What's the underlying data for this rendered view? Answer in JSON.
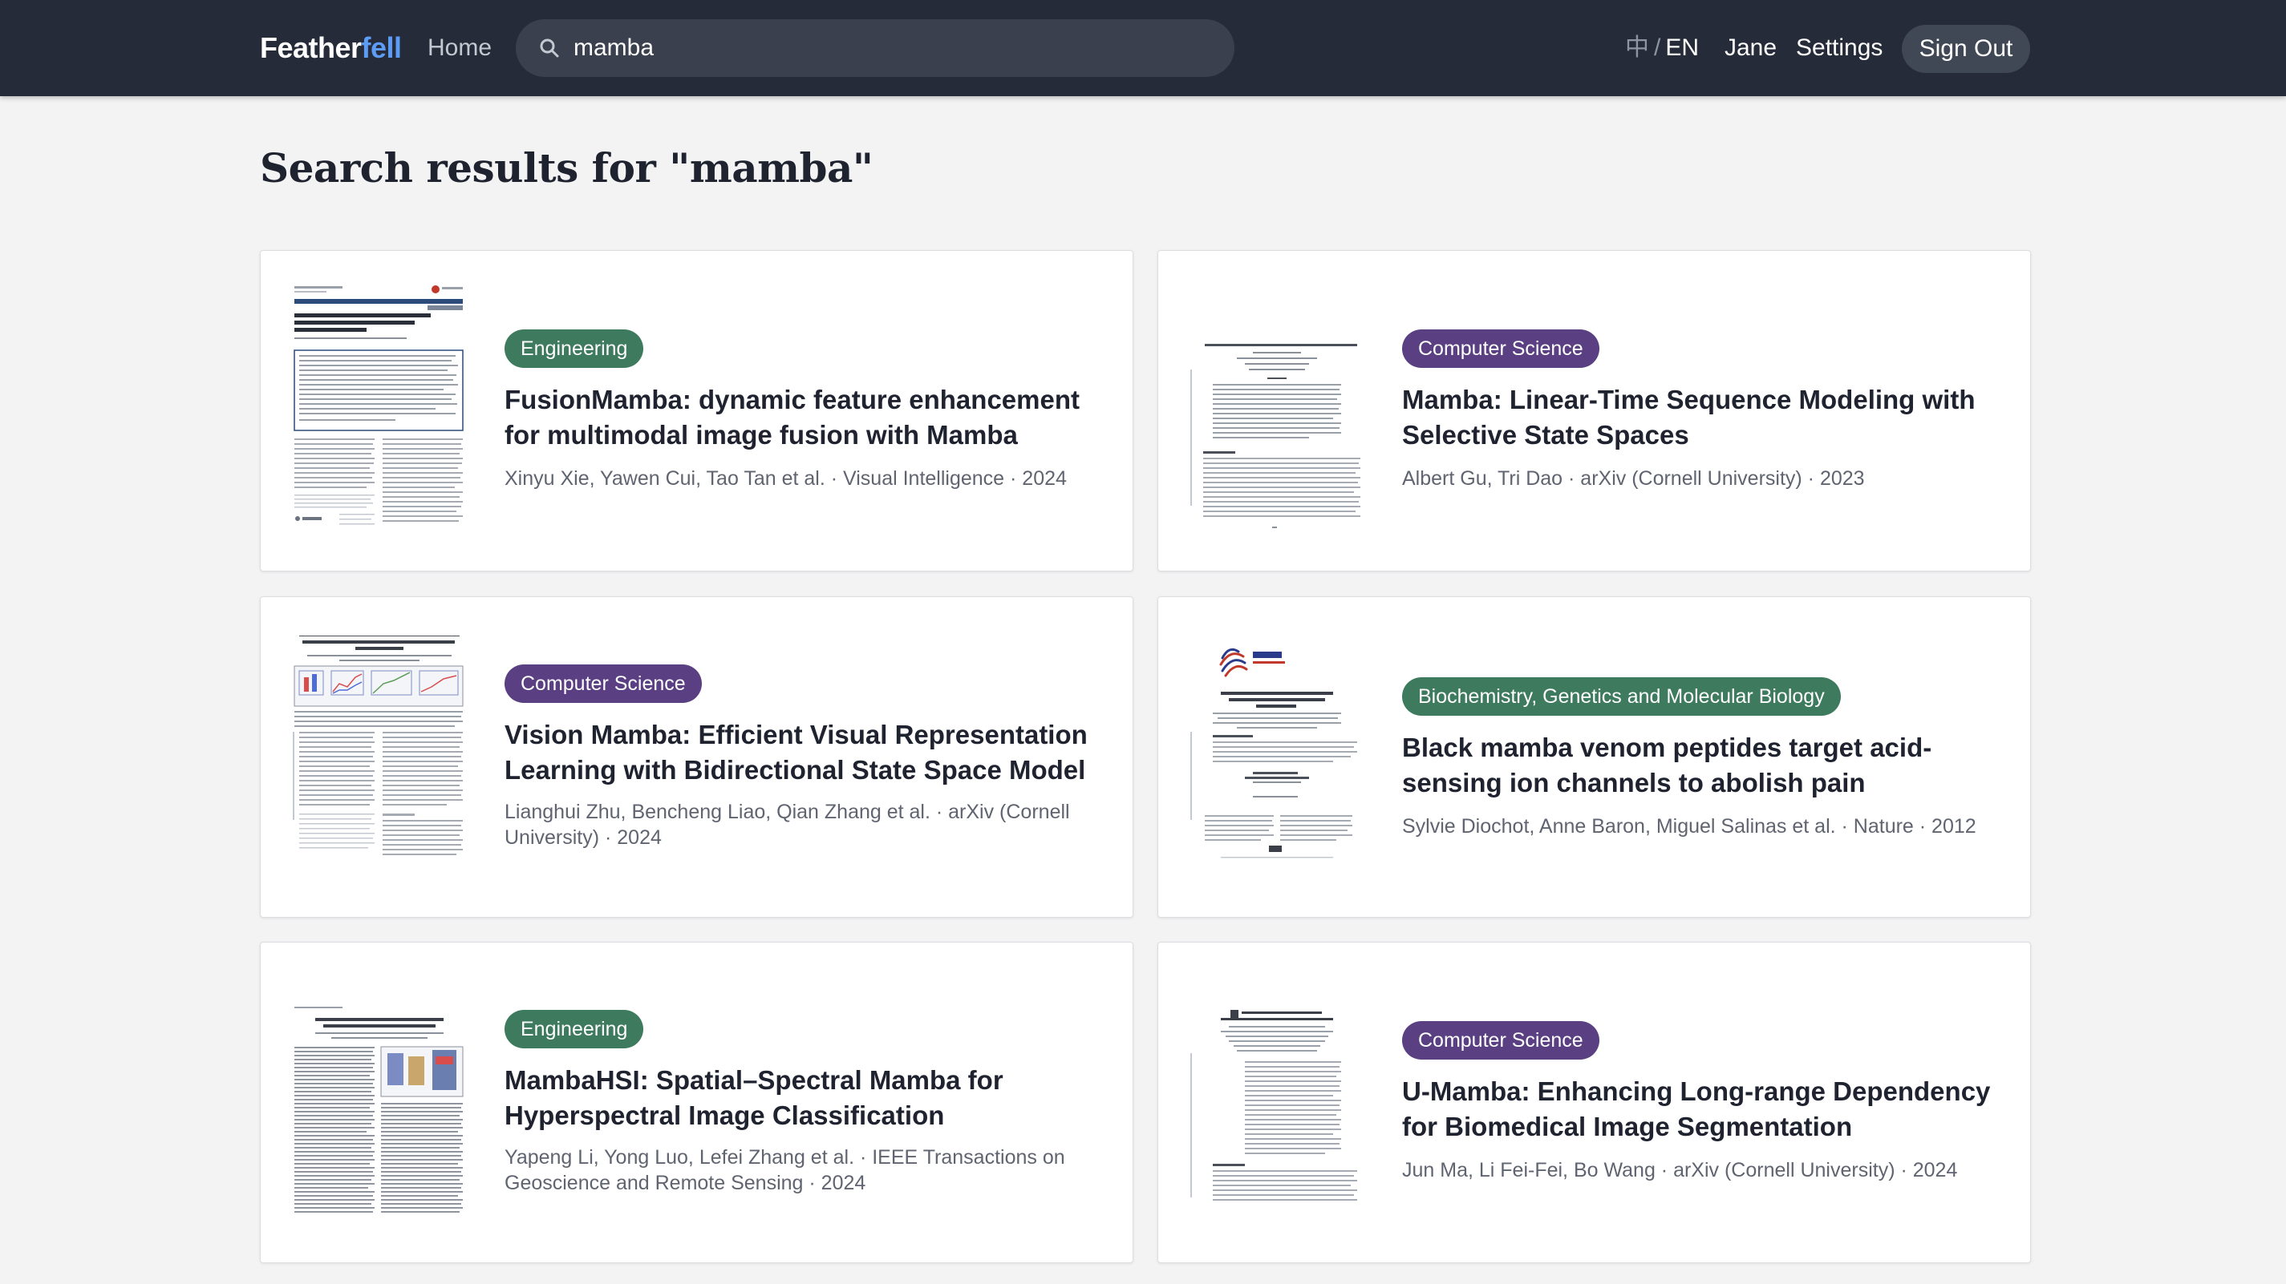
{
  "header": {
    "brand_part1": "Feather",
    "brand_part2": "fell",
    "home_label": "Home",
    "search": {
      "value": "mamba",
      "icon": "search-icon"
    },
    "lang_zh": "中",
    "lang_sep": "/",
    "lang_en": "EN",
    "user_label": "Jane",
    "settings_label": "Settings",
    "signout_label": "Sign Out"
  },
  "colors": {
    "topbar": "#252b38",
    "brand_accent": "#5c9cf5",
    "badge_engineering": "#3e7a5e",
    "badge_computer_science": "#5a3f82",
    "badge_biochemistry": "#3e7a5e"
  },
  "page": {
    "title": "Search results for \"mamba\""
  },
  "results": [
    {
      "category": "Engineering",
      "title": "FusionMamba: dynamic feature enhancement for multimodal image fusion with Mamba",
      "meta": "Xinyu Xie, Yawen Cui, Tao Tan et al. · Visual Intelligence · 2024"
    },
    {
      "category": "Computer Science",
      "title": "Mamba: Linear-Time Sequence Modeling with Selective State Spaces",
      "meta": "Albert Gu, Tri Dao · arXiv (Cornell University) · 2023"
    },
    {
      "category": "Computer Science",
      "title": "Vision Mamba: Efficient Visual Representation Learning with Bidirectional State Space Model",
      "meta": "Lianghui Zhu, Bencheng Liao, Qian Zhang et al. · arXiv (Cornell University) · 2024"
    },
    {
      "category": "Biochemistry, Genetics and Molecular Biology",
      "title": "Black mamba venom peptides target acid-sensing ion channels to abolish pain",
      "meta": "Sylvie Diochot, Anne Baron, Miguel Salinas et al. · Nature · 2012"
    },
    {
      "category": "Engineering",
      "title": "MambaHSI: Spatial–Spectral Mamba for Hyperspectral Image Classification",
      "meta": "Yapeng Li, Yong Luo, Lefei Zhang et al. · IEEE Transactions on Geoscience and Remote Sensing · 2024"
    },
    {
      "category": "Computer Science",
      "title": "U-Mamba: Enhancing Long-range Dependency for Biomedical Image Segmentation",
      "meta": "Jun Ma, Li Fei-Fei, Bo Wang · arXiv (Cornell University) · 2024"
    }
  ]
}
